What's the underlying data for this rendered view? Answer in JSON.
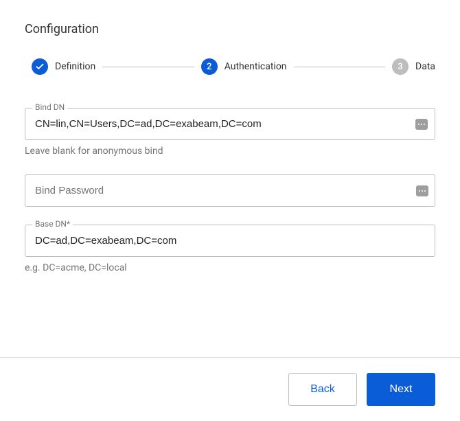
{
  "title": "Configuration",
  "stepper": {
    "step1": {
      "label": "Definition"
    },
    "step2": {
      "number": "2",
      "label": "Authentication"
    },
    "step3": {
      "number": "3",
      "label": "Data"
    }
  },
  "form": {
    "bind_dn": {
      "label": "Bind DN",
      "value": "CN=lin,CN=Users,DC=ad,DC=exabeam,DC=com",
      "helper": "Leave blank for anonymous bind"
    },
    "bind_password": {
      "placeholder": "Bind Password",
      "value": ""
    },
    "base_dn": {
      "label": "Base DN*",
      "value": "DC=ad,DC=exabeam,DC=com",
      "helper": "e.g. DC=acme, DC=local"
    }
  },
  "footer": {
    "back": "Back",
    "next": "Next"
  }
}
